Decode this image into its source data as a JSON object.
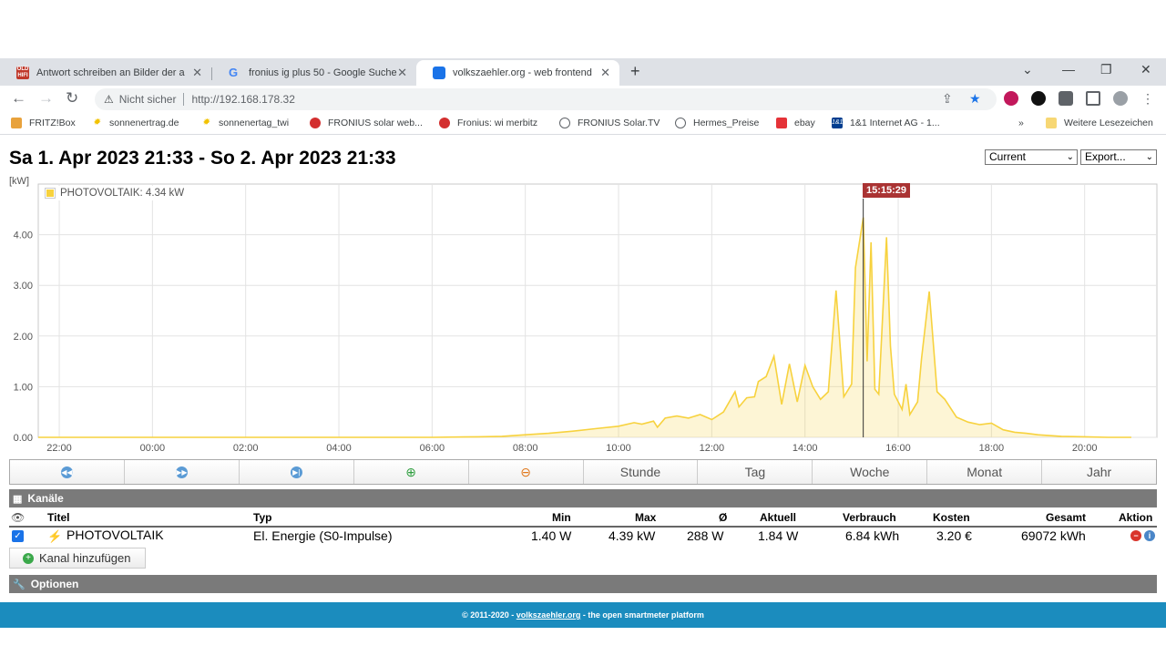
{
  "browser": {
    "tabs": [
      {
        "title": "Antwort schreiben an Bilder der a",
        "favicon": "hifi-forum-icon",
        "active": false
      },
      {
        "title": "fronius ig plus 50 - Google Suche",
        "favicon": "google-icon",
        "active": false
      },
      {
        "title": "volkszaehler.org - web frontend",
        "favicon": "volkszaehler-icon",
        "active": true
      }
    ],
    "security_label": "Nicht sicher",
    "url": "http://192.168.178.32",
    "bookmarks": [
      {
        "label": "FRITZ!Box"
      },
      {
        "label": "sonnenertrag.de"
      },
      {
        "label": "sonnenertag_twi"
      },
      {
        "label": "FRONIUS solar web..."
      },
      {
        "label": "Fronius: wi merbitz"
      },
      {
        "label": "FRONIUS Solar.TV"
      },
      {
        "label": "Hermes_Preise"
      },
      {
        "label": "ebay"
      },
      {
        "label": "1&1 Internet AG - 1..."
      }
    ],
    "more_bookmarks": "»",
    "other_bookmarks": "Weitere Lesezeichen"
  },
  "page": {
    "title": "Sa 1. Apr 2023 21:33 - So 2. Apr 2023 21:33",
    "mode_select": "Current",
    "export_select": "Export..."
  },
  "chart_data": {
    "type": "area",
    "ylabel": "[kW]",
    "ylim": [
      0,
      5.0
    ],
    "y_ticks": [
      "0.00",
      "1.00",
      "2.00",
      "3.00",
      "4.00"
    ],
    "x_ticks": [
      "22:00",
      "00:00",
      "02:00",
      "04:00",
      "06:00",
      "08:00",
      "10:00",
      "12:00",
      "14:00",
      "16:00",
      "18:00",
      "20:00"
    ],
    "x_range_hours": [
      21.55,
      45.55
    ],
    "legend": "PHOTOVOLTAIK: 4.34 kW",
    "series_color": "#f7d23e",
    "marker_label": "15:15:29",
    "marker_time": "15:15",
    "series": [
      {
        "name": "PHOTOVOLTAIK",
        "x": [
          "21:33",
          "22:00",
          "00:00",
          "02:00",
          "04:00",
          "06:00",
          "07:00",
          "07:30",
          "08:00",
          "08:30",
          "09:00",
          "09:30",
          "10:00",
          "10:20",
          "10:30",
          "10:45",
          "10:50",
          "11:00",
          "11:15",
          "11:30",
          "11:45",
          "12:00",
          "12:15",
          "12:30",
          "12:35",
          "12:45",
          "12:55",
          "13:00",
          "13:10",
          "13:20",
          "13:30",
          "13:40",
          "13:50",
          "14:00",
          "14:10",
          "14:20",
          "14:30",
          "14:40",
          "14:50",
          "15:00",
          "15:05",
          "15:15",
          "15:20",
          "15:25",
          "15:30",
          "15:35",
          "15:45",
          "15:50",
          "15:55",
          "16:05",
          "16:10",
          "16:15",
          "16:25",
          "16:30",
          "16:40",
          "16:50",
          "17:00",
          "17:15",
          "17:30",
          "17:45",
          "18:00",
          "18:15",
          "18:30",
          "18:45",
          "19:00",
          "19:30",
          "20:00",
          "20:30",
          "21:00"
        ],
        "y": [
          0.0,
          0.0,
          0.0,
          0.0,
          0.0,
          0.0,
          0.01,
          0.02,
          0.05,
          0.08,
          0.12,
          0.17,
          0.22,
          0.29,
          0.26,
          0.32,
          0.2,
          0.38,
          0.42,
          0.38,
          0.45,
          0.35,
          0.5,
          0.9,
          0.6,
          0.78,
          0.8,
          1.1,
          1.2,
          1.6,
          0.65,
          1.45,
          0.7,
          1.42,
          1.0,
          0.75,
          0.9,
          2.9,
          0.8,
          1.05,
          3.35,
          4.34,
          1.5,
          3.85,
          0.95,
          0.85,
          3.95,
          1.8,
          0.85,
          0.55,
          1.05,
          0.45,
          0.7,
          1.55,
          2.88,
          0.9,
          0.75,
          0.4,
          0.3,
          0.25,
          0.28,
          0.15,
          0.1,
          0.08,
          0.05,
          0.02,
          0.01,
          0.0,
          0.0
        ]
      }
    ]
  },
  "controls": {
    "buttons": [
      "Stunde",
      "Tag",
      "Woche",
      "Monat",
      "Jahr"
    ]
  },
  "channels": {
    "section_title": "Kanäle",
    "headers": {
      "titel": "Titel",
      "typ": "Typ",
      "min": "Min",
      "max": "Max",
      "avg": "Ø",
      "aktuell": "Aktuell",
      "verbrauch": "Verbrauch",
      "kosten": "Kosten",
      "gesamt": "Gesamt",
      "aktion": "Aktion"
    },
    "rows": [
      {
        "titel": "PHOTOVOLTAIK",
        "typ": "El. Energie (S0-Impulse)",
        "min": "1.40 W",
        "max": "4.39 kW",
        "avg": "288 W",
        "aktuell": "1.84 W",
        "verbrauch": "6.84 kWh",
        "kosten": "3.20 €",
        "gesamt": "69072 kWh"
      }
    ],
    "add_label": "Kanal hinzufügen"
  },
  "options": {
    "section_title": "Optionen"
  },
  "footer": {
    "prefix": "© 2011-2020 - ",
    "link": "volkszaehler.org",
    "suffix": " - the open smartmeter platform"
  }
}
